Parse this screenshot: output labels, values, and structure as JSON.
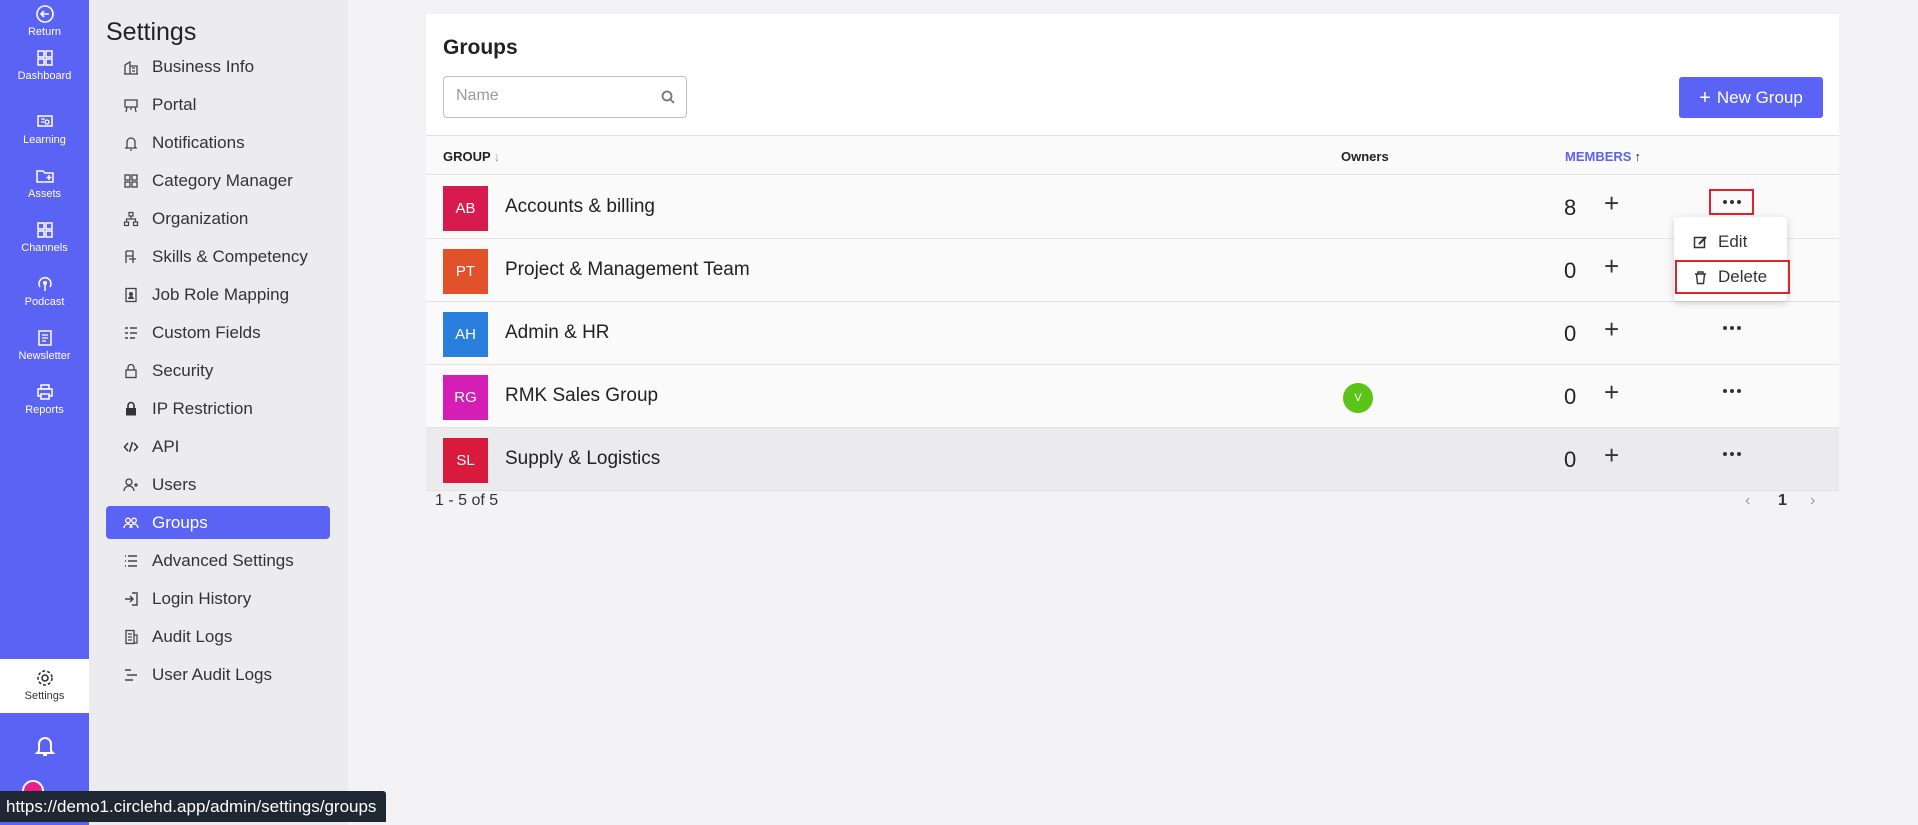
{
  "rail": {
    "items": [
      {
        "label": "Return",
        "icon": "return-icon"
      },
      {
        "label": "Dashboard",
        "icon": "dashboard-icon"
      },
      {
        "label": "Learning",
        "icon": "learning-icon"
      },
      {
        "label": "Assets",
        "icon": "assets-icon"
      },
      {
        "label": "Channels",
        "icon": "channels-icon"
      },
      {
        "label": "Podcast",
        "icon": "podcast-icon"
      },
      {
        "label": "Newsletter",
        "icon": "newsletter-icon"
      },
      {
        "label": "Reports",
        "icon": "reports-icon"
      }
    ],
    "settings_label": "Settings"
  },
  "settings": {
    "title": "Settings",
    "items": [
      {
        "label": "Business Info",
        "icon": "building-icon"
      },
      {
        "label": "Portal",
        "icon": "portal-icon"
      },
      {
        "label": "Notifications",
        "icon": "bell-icon"
      },
      {
        "label": "Category Manager",
        "icon": "grid-icon"
      },
      {
        "label": "Organization",
        "icon": "org-chart-icon"
      },
      {
        "label": "Skills & Competency",
        "icon": "skills-icon"
      },
      {
        "label": "Job Role Mapping",
        "icon": "id-badge-icon"
      },
      {
        "label": "Custom Fields",
        "icon": "fields-icon"
      },
      {
        "label": "Security",
        "icon": "lock-open-icon"
      },
      {
        "label": "IP Restriction",
        "icon": "lock-icon"
      },
      {
        "label": "API",
        "icon": "code-icon"
      },
      {
        "label": "Users",
        "icon": "user-add-icon"
      },
      {
        "label": "Groups",
        "icon": "groups-icon",
        "active": true
      },
      {
        "label": "Advanced Settings",
        "icon": "list-icon"
      },
      {
        "label": "Login History",
        "icon": "login-icon"
      },
      {
        "label": "Audit Logs",
        "icon": "audit-icon"
      },
      {
        "label": "User Audit Logs",
        "icon": "user-audit-icon"
      }
    ]
  },
  "main": {
    "title": "Groups",
    "search_placeholder": "Name",
    "new_group_label": "New Group",
    "columns": {
      "group": "GROUP",
      "owners": "Owners",
      "members": "MEMBERS"
    },
    "rows": [
      {
        "initials": "AB",
        "name": "Accounts & billing",
        "color": "#d81b4f",
        "owner": "",
        "members": "8"
      },
      {
        "initials": "PT",
        "name": "Project & Management Team",
        "color": "#e1522a",
        "owner": "",
        "members": "0"
      },
      {
        "initials": "AH",
        "name": "Admin & HR",
        "color": "#2a7fdc",
        "owner": "",
        "members": "0"
      },
      {
        "initials": "RG",
        "name": "RMK Sales Group",
        "color": "#d41eb5",
        "owner": "V",
        "members": "0"
      },
      {
        "initials": "SL",
        "name": "Supply & Logistics",
        "color": "#d81b3c",
        "owner": "",
        "members": "0"
      }
    ],
    "menu": {
      "edit": "Edit",
      "delete": "Delete"
    },
    "pagination": {
      "info": "1 - 5 of 5",
      "page": "1"
    }
  },
  "status_url": "https://demo1.circlehd.app/admin/settings/groups",
  "colors": {
    "accent": "#5b63f5",
    "highlight_border": "#e0242c"
  }
}
